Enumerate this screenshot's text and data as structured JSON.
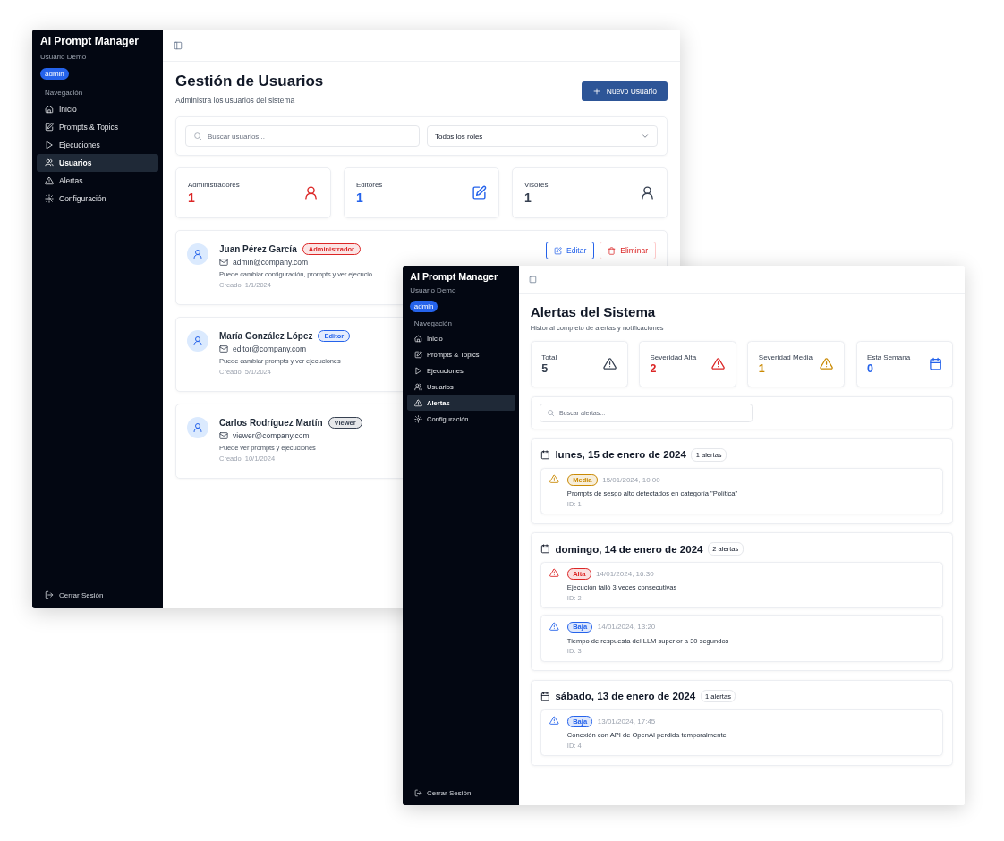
{
  "windows": [
    {
      "kind": "users",
      "sidebar": {
        "title": "AI Prompt Manager",
        "user": "Usuario Demo",
        "badge": "admin",
        "nav_heading": "Navegación",
        "items": [
          {
            "label": "Inicio",
            "selected": false
          },
          {
            "label": "Prompts & Topics",
            "selected": false
          },
          {
            "label": "Ejecuciones",
            "selected": false
          },
          {
            "label": "Usuarios",
            "selected": true
          },
          {
            "label": "Alertas",
            "selected": false
          },
          {
            "label": "Configuración",
            "selected": false
          }
        ],
        "logout": "Cerrar Sesión"
      },
      "title": "Gestión de Usuarios",
      "subtitle": "Administra los usuarios del sistema",
      "new_button": "Nuevo Usuario",
      "search_placeholder": "Buscar usuarios...",
      "role_select": "Todos los roles",
      "stats": [
        {
          "label": "Administradores",
          "value": "1",
          "color": "#dc2626",
          "kind": "user"
        },
        {
          "label": "Editores",
          "value": "1",
          "color": "#2563eb",
          "kind": "edit"
        },
        {
          "label": "Visores",
          "value": "1",
          "color": "#374151",
          "kind": "user"
        }
      ],
      "users": [
        {
          "name": "Juan Pérez García",
          "role": "Administrador",
          "color": "#dc2626",
          "email": "admin@company.com",
          "permissions": "Puede cambiar configuración, prompts y ver ejecucio",
          "created": "Creado: 1/1/2024",
          "actions": [
            "Editar",
            "Eliminar"
          ]
        },
        {
          "name": "María González López",
          "role": "Editor",
          "color": "#2563eb",
          "email": "editor@company.com",
          "permissions": "Puede cambiar prompts y ver ejecuciones",
          "created": "Creado: 5/1/2024"
        },
        {
          "name": "Carlos Rodríguez Martín",
          "role": "Viewer",
          "color": "#374151",
          "email": "viewer@company.com",
          "permissions": "Puede ver prompts y ejecuciones",
          "created": "Creado: 10/1/2024"
        }
      ]
    },
    {
      "kind": "alerts",
      "sidebar": {
        "title": "AI Prompt Manager",
        "user": "Usuario Demo",
        "badge": "admin",
        "nav_heading": "Navegación",
        "items": [
          {
            "label": "Inicio",
            "selected": false
          },
          {
            "label": "Prompts & Topics",
            "selected": false
          },
          {
            "label": "Ejecuciones",
            "selected": false
          },
          {
            "label": "Usuarios",
            "selected": false
          },
          {
            "label": "Alertas",
            "selected": true
          },
          {
            "label": "Configuración",
            "selected": false
          }
        ],
        "logout": "Cerrar Sesión"
      },
      "title": "Alertas del Sistema",
      "subtitle": "Historial completo de alertas y notificaciones",
      "stats": [
        {
          "label": "Total",
          "value": "5",
          "color": "#374151",
          "kind": "warning"
        },
        {
          "label": "Severidad Alta",
          "value": "2",
          "color": "#dc2626",
          "kind": "warning"
        },
        {
          "label": "Severidad Media",
          "value": "1",
          "color": "#ca8a04",
          "kind": "warning"
        },
        {
          "label": "Esta Semana",
          "value": "0",
          "color": "#2563eb",
          "kind": "calendar"
        }
      ],
      "search_placeholder": "Buscar alertas...",
      "groups": [
        {
          "date": "lunes, 15 de enero de 2024",
          "count": "1 alertas",
          "alerts": [
            {
              "severity": "Media",
              "color": "#ca8a04",
              "time": "15/01/2024, 10:00",
              "message": "Prompts de sesgo alto detectados en categoría \"Política\"",
              "id": "ID: 1"
            }
          ]
        },
        {
          "date": "domingo, 14 de enero de 2024",
          "count": "2 alertas",
          "alerts": [
            {
              "severity": "Alta",
              "color": "#dc2626",
              "time": "14/01/2024, 16:30",
              "message": "Ejecución falló 3 veces consecutivas",
              "id": "ID: 2"
            },
            {
              "severity": "Baja",
              "color": "#2563eb",
              "time": "14/01/2024, 13:20",
              "message": "Tiempo de respuesta del LLM superior a 30 segundos",
              "id": "ID: 3"
            }
          ]
        },
        {
          "date": "sábado, 13 de enero de 2024",
          "count": "1 alertas",
          "alerts": [
            {
              "severity": "Baja",
              "color": "#2563eb",
              "time": "13/01/2024, 17:45",
              "message": "Conexión con API de OpenAI perdida temporalmente",
              "id": "ID: 4"
            }
          ]
        }
      ]
    }
  ]
}
